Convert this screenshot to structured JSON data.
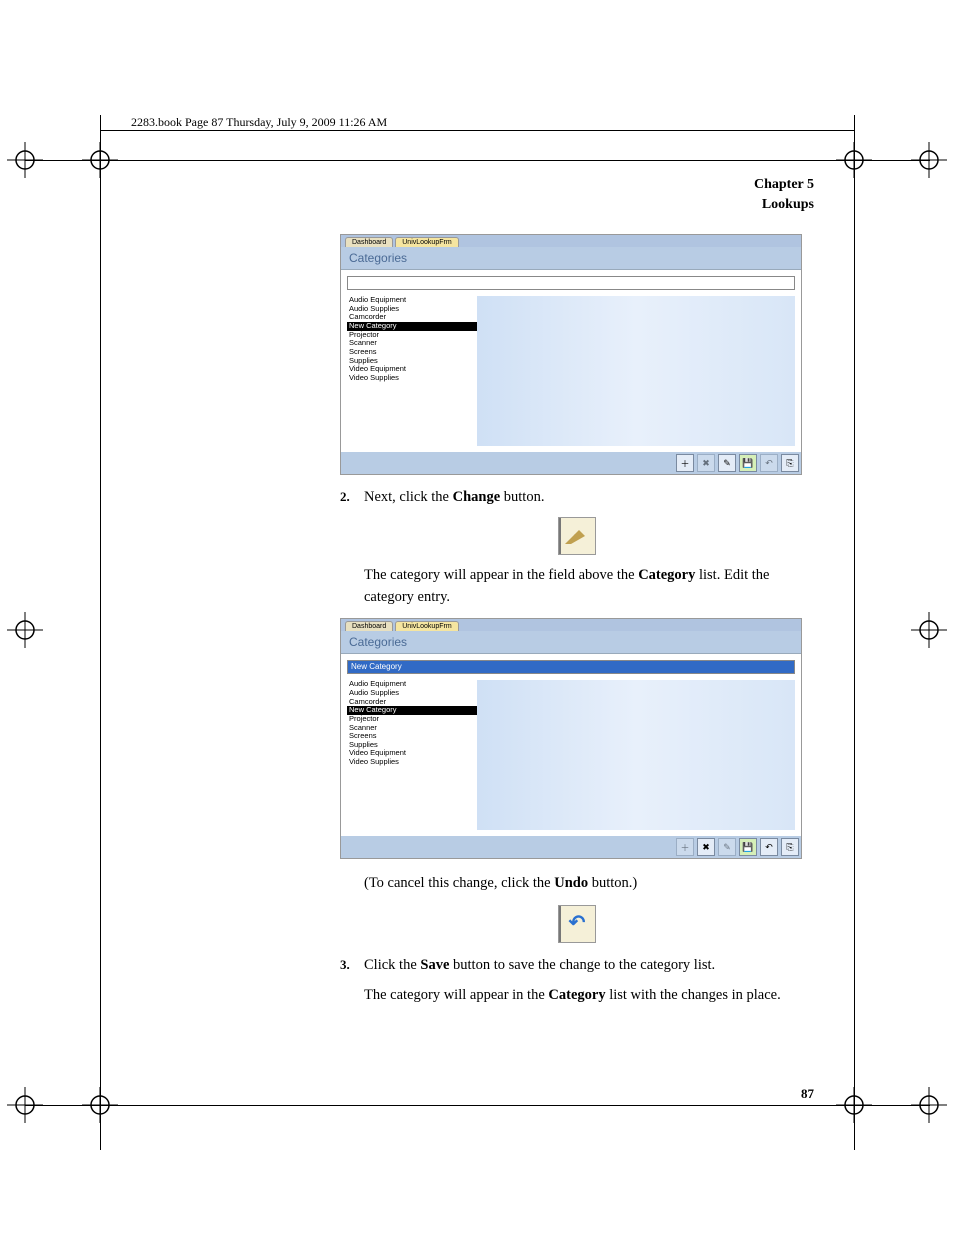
{
  "header": {
    "line": "2283.book  Page 87  Thursday, July 9, 2009  11:26 AM"
  },
  "chapter": {
    "line1": "Chapter 5",
    "line2": "Lookups"
  },
  "screenshot1": {
    "tabs": [
      "Dashboard",
      "UnivLookupFrm"
    ],
    "title": "Categories",
    "input_value": "",
    "items": [
      "Audio Equipment",
      "Audio Supplies",
      "Camcorder",
      "New Category",
      "Projector",
      "Scanner",
      "Screens",
      "Supplies",
      "Video Equipment",
      "Video Supplies"
    ],
    "selected_index": 3,
    "toolbar_icons": [
      "add",
      "delete",
      "change",
      "save",
      "undo",
      "exit"
    ]
  },
  "step2": {
    "num": "2.",
    "text_a": "Next, click the ",
    "bold_a": "Change",
    "text_b": " button."
  },
  "para1": {
    "text_a": "The category will appear in the field above the ",
    "bold_a": "Category",
    "text_b": " list. Edit the category entry."
  },
  "screenshot2": {
    "tabs": [
      "Dashboard",
      "UnivLookupFrm"
    ],
    "title": "Categories",
    "input_value": "New Category",
    "items": [
      "Audio Equipment",
      "Audio Supplies",
      "Camcorder",
      "New Category",
      "Projector",
      "Scanner",
      "Screens",
      "Supplies",
      "Video Equipment",
      "Video Supplies"
    ],
    "selected_index": 3,
    "toolbar_icons": [
      "add",
      "delete",
      "change",
      "save",
      "undo",
      "exit"
    ]
  },
  "para2": {
    "text_a": "(To cancel this change, click the ",
    "bold_a": "Undo",
    "text_b": " button.)"
  },
  "step3": {
    "num": "3.",
    "text_a": "Click the ",
    "bold_a": "Save",
    "text_b": " button to save the change to the category list."
  },
  "para3": {
    "text_a": "The category will appear in the ",
    "bold_a": "Category",
    "text_b": " list with the changes in place."
  },
  "page_number": "87"
}
